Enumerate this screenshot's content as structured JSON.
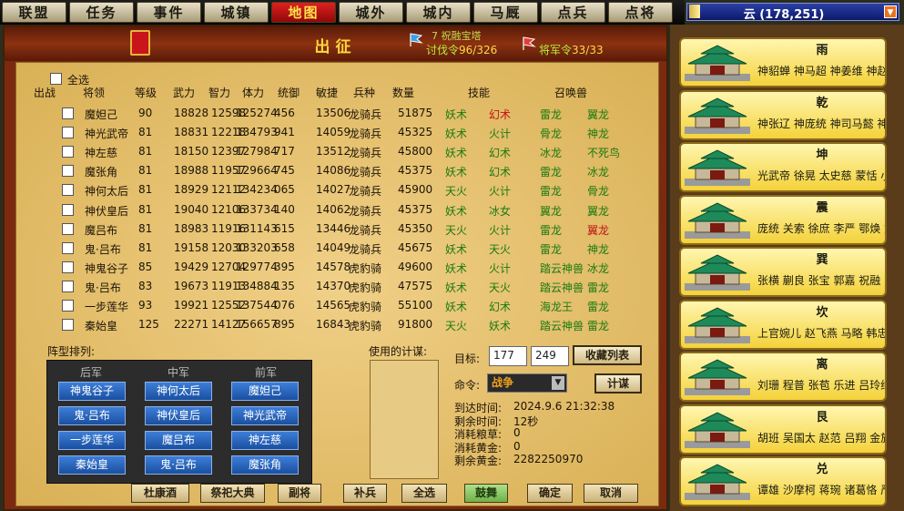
{
  "nav": {
    "tabs": [
      "联盟",
      "任务",
      "事件",
      "城镇",
      "地图",
      "城外",
      "城内",
      "马厩",
      "点兵",
      "点将"
    ],
    "active_index": 4,
    "region_label": "云 (178,251)"
  },
  "main": {
    "title": "出征",
    "stats": {
      "subtitle": "7 祝融宝塔",
      "tafa_label": "讨伐令",
      "tafa_value": "96/326",
      "jiang_label": "将军令",
      "jiang_value": "33/33"
    },
    "select_all": "全选",
    "headers": [
      "出战",
      "将领",
      "等级",
      "武力",
      "智力",
      "体力",
      "统御",
      "敏捷",
      "兵种",
      "数量",
      "技能",
      "召唤兽"
    ],
    "rows": [
      {
        "name": "魔妲己",
        "level": "90",
        "wu": "18828",
        "zhi": "12598",
        "ti": "125274",
        "tong": "456",
        "min": "13506",
        "bing": "龙骑兵",
        "num": "51875",
        "sk1": "妖术",
        "sk2": "幻术",
        "sk2c": "r",
        "s1": "雷龙",
        "s2": "翼龙"
      },
      {
        "name": "神光武帝",
        "level": "81",
        "wu": "18831",
        "zhi": "12218",
        "ti": "134793",
        "tong": "941",
        "min": "14059",
        "bing": "龙骑兵",
        "num": "45325",
        "sk1": "妖术",
        "sk2": "火计",
        "sk2c": "g",
        "s1": "骨龙",
        "s2": "神龙"
      },
      {
        "name": "神左慈",
        "level": "81",
        "wu": "18150",
        "zhi": "12397",
        "ti": "127984",
        "tong": "717",
        "min": "13512",
        "bing": "龙骑兵",
        "num": "45800",
        "sk1": "妖术",
        "sk2": "幻术",
        "sk2c": "g",
        "s1": "冰龙",
        "s2": "不死鸟"
      },
      {
        "name": "魔张角",
        "level": "81",
        "wu": "18988",
        "zhi": "11957",
        "ti": "129664",
        "tong": "745",
        "min": "14086",
        "bing": "龙骑兵",
        "num": "45375",
        "sk1": "妖术",
        "sk2": "幻术",
        "sk2c": "g",
        "s1": "雷龙",
        "s2": "冰龙"
      },
      {
        "name": "神何太后",
        "level": "81",
        "wu": "18929",
        "zhi": "12112",
        "ti": "134234",
        "tong": "065",
        "min": "14027",
        "bing": "龙骑兵",
        "num": "45900",
        "sk1": "天火",
        "sk2": "火计",
        "sk2c": "g",
        "s1": "雷龙",
        "s2": "骨龙"
      },
      {
        "name": "神伏皇后",
        "level": "81",
        "wu": "19040",
        "zhi": "12106",
        "ti": "133734",
        "tong": "140",
        "min": "14062",
        "bing": "龙骑兵",
        "num": "45375",
        "sk1": "妖术",
        "sk2": "冰女",
        "sk2c": "g",
        "s1": "翼龙",
        "s2": "翼龙"
      },
      {
        "name": "魔吕布",
        "level": "81",
        "wu": "18983",
        "zhi": "11916",
        "ti": "131143",
        "tong": "615",
        "min": "13446",
        "bing": "龙骑兵",
        "num": "45350",
        "sk1": "天火",
        "sk2": "火计",
        "sk2c": "g",
        "s1": "雷龙",
        "s2": "翼龙",
        "s2c": "r"
      },
      {
        "name": "鬼·吕布",
        "level": "81",
        "wu": "19158",
        "zhi": "12030",
        "ti": "133203",
        "tong": "658",
        "min": "14049",
        "bing": "龙骑兵",
        "num": "45675",
        "sk1": "妖术",
        "sk2": "天火",
        "sk2c": "g",
        "s1": "雷龙",
        "s2": "神龙"
      },
      {
        "name": "神鬼谷子",
        "level": "85",
        "wu": "19429",
        "zhi": "12704",
        "ti": "129774",
        "tong": "395",
        "min": "14578",
        "bing": "虎豹骑",
        "num": "49600",
        "sk1": "妖术",
        "sk2": "火计",
        "sk2c": "g",
        "s1": "踏云神兽",
        "s2": "冰龙"
      },
      {
        "name": "鬼·吕布",
        "level": "83",
        "wu": "19673",
        "zhi": "11913",
        "ti": "134884",
        "tong": "135",
        "min": "14370",
        "bing": "虎豹骑",
        "num": "47575",
        "sk1": "妖术",
        "sk2": "天火",
        "sk2c": "g",
        "s1": "踏云神兽",
        "s2": "雷龙"
      },
      {
        "name": "一步莲华",
        "level": "93",
        "wu": "19921",
        "zhi": "12552",
        "ti": "137544",
        "tong": "076",
        "min": "14565",
        "bing": "虎豹骑",
        "num": "55100",
        "sk1": "妖术",
        "sk2": "幻术",
        "sk2c": "g",
        "s1": "海龙王",
        "s2": "雷龙"
      },
      {
        "name": "秦始皇",
        "level": "125",
        "wu": "22271",
        "zhi": "14127",
        "ti": "156657",
        "tong": "895",
        "min": "16843",
        "bing": "虎豹骑",
        "num": "91800",
        "sk1": "天火",
        "sk2": "妖术",
        "sk2c": "g",
        "s1": "踏云神兽",
        "s2": "雷龙"
      }
    ],
    "formation": {
      "label": "阵型排列:",
      "cols": [
        "后军",
        "中军",
        "前军"
      ],
      "rear": [
        "神鬼谷子",
        "鬼·吕布",
        "一步莲华",
        "秦始皇"
      ],
      "mid": [
        "神何太后",
        "神伏皇后",
        "魔吕布",
        "鬼·吕布"
      ],
      "front": [
        "魔妲己",
        "神光武帝",
        "神左慈",
        "魔张角"
      ]
    },
    "used_label": "使用的计谋:",
    "target_label": "目标:",
    "target_x": "177",
    "target_y": "249",
    "fav_btn": "收藏列表",
    "cmd_label": "命令:",
    "cmd_value": "战争",
    "plan_btn": "计谋",
    "info": [
      {
        "k": "到达时间:",
        "v": "2024.9.6   21:32:38"
      },
      {
        "k": "剩余时间:",
        "v": "12秒"
      },
      {
        "k": "消耗粮草:",
        "v": "0"
      },
      {
        "k": "消耗黄金:",
        "v": "0"
      },
      {
        "k": "剩余黄金:",
        "v": "2282250970"
      }
    ],
    "bottom_buttons": [
      "杜康酒",
      "祭祀大典",
      "副将",
      "补兵",
      "全选",
      "鼓舞",
      "确定",
      "取消"
    ]
  },
  "cities": [
    {
      "name": "雨",
      "gens": "神貂蝉 神马超 神姜维 神赵"
    },
    {
      "name": "乾",
      "gens": "神张辽 神庞统 神司马懿 神"
    },
    {
      "name": "坤",
      "gens": "光武帝 徐晃 太史慈 蒙恬 小"
    },
    {
      "name": "震",
      "gens": "庞统 关索 徐庶 李严 鄂焕 刘"
    },
    {
      "name": "巽",
      "gens": "张横 蒯良 张宝 郭嘉 祝融 张"
    },
    {
      "name": "坎",
      "gens": "上官婉儿 赵飞燕 马略 韩忠"
    },
    {
      "name": "离",
      "gens": "刘珊 程普 张苞 乐进 吕玲绮"
    },
    {
      "name": "艮",
      "gens": "胡班 吴国太 赵范 吕翔 金旋"
    },
    {
      "name": "兑",
      "gens": "谭雄 沙摩柯 蒋琬 诸葛恪 严"
    }
  ]
}
